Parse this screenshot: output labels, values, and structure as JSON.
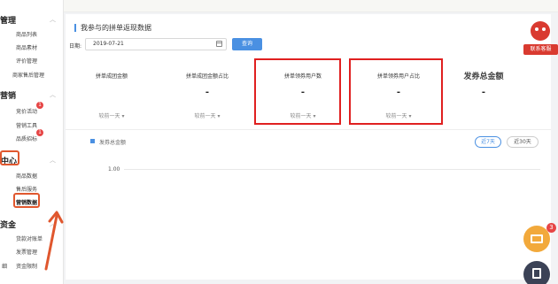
{
  "sidebar": {
    "sections": [
      {
        "title": "管理",
        "items": [
          "商品列表",
          "商品素材",
          "评价管理",
          "商家售后管理"
        ]
      },
      {
        "title": "营销",
        "items": [
          "竞价活动",
          "营销工具",
          "品质招标"
        ]
      },
      {
        "title": "中心",
        "items": [
          "商品数据",
          "售后服务",
          "营销数据"
        ]
      },
      {
        "title": "资金",
        "items": [
          "货款对账单",
          "发票管理",
          "资金限制"
        ]
      }
    ],
    "badges": {
      "bidding": "1",
      "quality": "1"
    },
    "stray_label": "细"
  },
  "page": {
    "title": "我参与的拼单返现数据",
    "date_label": "日期:",
    "date_value": "2019-07-21",
    "query_label": "查询"
  },
  "metrics": [
    {
      "title": "拼单成团金额",
      "value": "",
      "compare": "较前一天"
    },
    {
      "title": "拼单成团金额占比",
      "value": "-",
      "compare": "较前一天"
    },
    {
      "title": "拼单领券用户数",
      "value": "-",
      "compare": "较前一天"
    },
    {
      "title": "拼单领券用户占比",
      "value": "-",
      "compare": "较前一天"
    },
    {
      "title": "发券总金额",
      "value": "-",
      "compare": ""
    }
  ],
  "chart": {
    "legend": "发券总金额",
    "range_7": "近7天",
    "range_30": "近30天",
    "y_tick": "1.00"
  },
  "widgets": {
    "contact_label": "联系客服",
    "message_count": "3"
  },
  "colors": {
    "accent": "#4a90e2",
    "highlight": "#e02020",
    "annotation": "#e0572e"
  }
}
